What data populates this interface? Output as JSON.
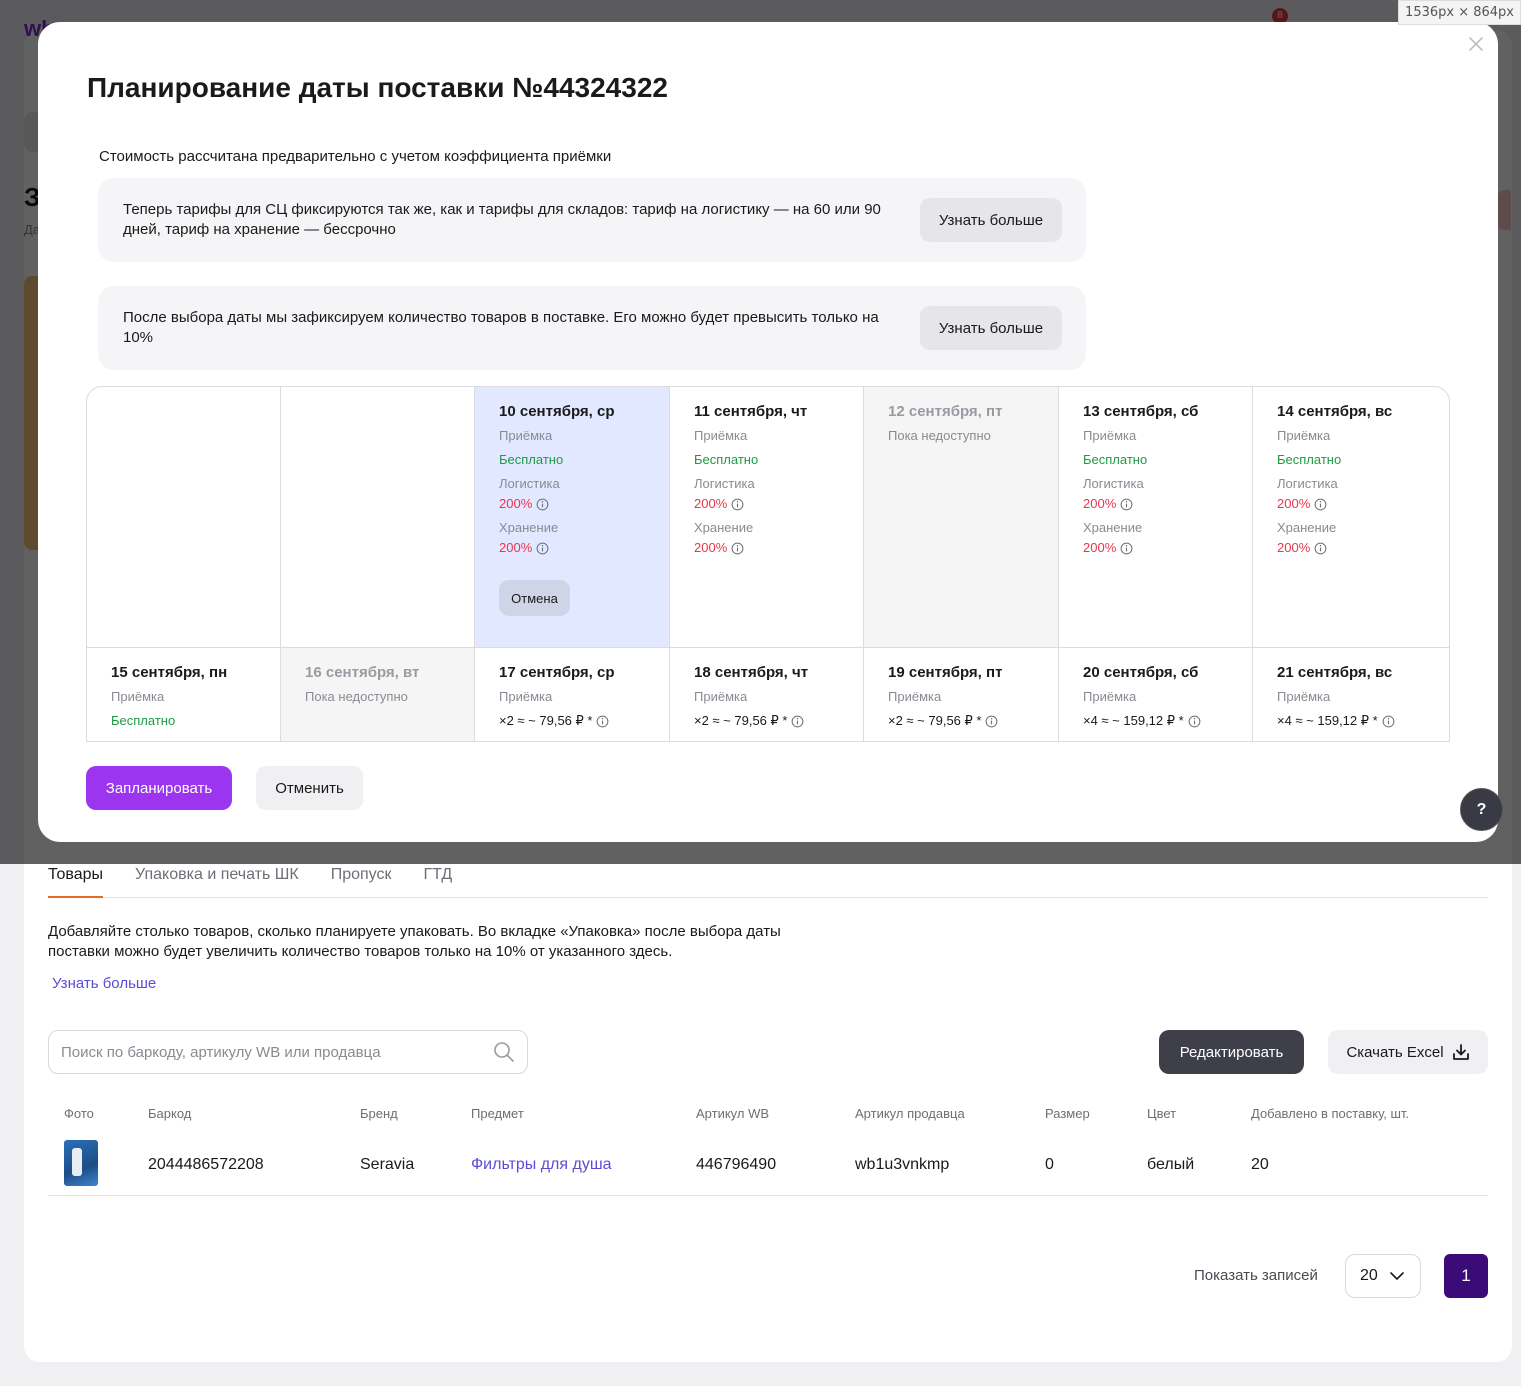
{
  "window": {
    "size_label": "1536px × 864px"
  },
  "background": {
    "logo": "wb",
    "notification_count": "8",
    "heading": "З",
    "subheading": "Да",
    "tabs": [
      {
        "label": "Товары",
        "active": true
      },
      {
        "label": "Упаковка и печать ШК",
        "active": false
      },
      {
        "label": "Пропуск",
        "active": false
      },
      {
        "label": "ГТД",
        "active": false
      }
    ],
    "info_text": "Добавляйте столько товаров, сколько планируете упаковать. Во вкладке «Упаковка» после выбора даты поставки можно будет увеличить количество товаров только на 10% от указанного здесь.",
    "learn_more": "Узнать больше",
    "search": {
      "placeholder": "Поиск по баркоду, артикулу WB или продавца",
      "value": ""
    },
    "edit_button": "Редактировать",
    "excel_button": "Скачать Excel",
    "table": {
      "headers": {
        "photo": "Фото",
        "barcode": "Баркод",
        "brand": "Бренд",
        "subject": "Предмет",
        "wb_article": "Артикул WB",
        "seller_article": "Артикул продавца",
        "size": "Размер",
        "color": "Цвет",
        "added": "Добавлено в поставку, шт."
      },
      "rows": [
        {
          "barcode": "2044486572208",
          "brand": "Seravia",
          "subject": "Фильтры для душа",
          "wb_article": "446796490",
          "seller_article": "wb1u3vnkmp",
          "size": "0",
          "color": "белый",
          "added": "20"
        }
      ]
    },
    "pagination": {
      "label": "Показать записей",
      "per_page": "20",
      "current_page": "1"
    }
  },
  "modal": {
    "title": "Планирование даты поставки №44324322",
    "cost_note": "Стоимость рассчитана предварительно с учетом коэффициента приёмки",
    "notices": [
      {
        "text": "Теперь тарифы для СЦ фиксируются так же, как и тарифы для складов: тариф на логистику — на 60 или 90 дней, тариф на хранение — бессрочно",
        "button": "Узнать больше"
      },
      {
        "text": "После выбора даты мы зафиксируем количество товаров в поставке. Его можно будет превысить только на 10%",
        "button": "Узнать больше"
      }
    ],
    "labels": {
      "acceptance": "Приёмка",
      "logistics": "Логистика",
      "storage": "Хранение"
    },
    "calendar_week1": [
      {
        "date": "",
        "empty": true
      },
      {
        "date": "",
        "empty": true
      },
      {
        "date": "10 сентября, ср",
        "selected": true,
        "acceptance": "Бесплатно",
        "logistics": "200%",
        "storage": "200%",
        "cancel_label": "Отмена"
      },
      {
        "date": "11 сентября, чт",
        "acceptance": "Бесплатно",
        "logistics": "200%",
        "storage": "200%"
      },
      {
        "date": "12 сентября, пт",
        "unavailable": "Пока недоступно"
      },
      {
        "date": "13 сентября, сб",
        "acceptance": "Бесплатно",
        "logistics": "200%",
        "storage": "200%"
      },
      {
        "date": "14 сентября, вс",
        "acceptance": "Бесплатно",
        "logistics": "200%",
        "storage": "200%"
      }
    ],
    "calendar_week2": [
      {
        "date": "15 сентября, пн",
        "acceptance_free": "Бесплатно"
      },
      {
        "date": "16 сентября, вт",
        "unavailable": "Пока недоступно"
      },
      {
        "date": "17 сентября, ср",
        "acceptance_cost": "×2 ≈ ~ 79,56 ₽ *"
      },
      {
        "date": "18 сентября, чт",
        "acceptance_cost": "×2 ≈ ~ 79,56 ₽ *"
      },
      {
        "date": "19 сентября, пт",
        "acceptance_cost": "×2 ≈ ~ 79,56 ₽ *"
      },
      {
        "date": "20 сентября, сб",
        "acceptance_cost": "×4 ≈ ~ 159,12 ₽ *"
      },
      {
        "date": "21 сентября, вс",
        "acceptance_cost": "×4 ≈ ~ 159,12 ₽ *"
      }
    ],
    "plan_button": "Запланировать",
    "cancel_button": "Отменить"
  },
  "help_button": "?",
  "colors": {
    "accent": "#9b35f0",
    "free": "#1f9a45",
    "rate": "#e8374d",
    "selected_bg": "#e2e8ff",
    "page_active": "#3b0b78"
  },
  "icons": [
    "close-icon",
    "info-icon",
    "search-icon",
    "download-icon",
    "chevron-down-icon",
    "help-icon"
  ]
}
